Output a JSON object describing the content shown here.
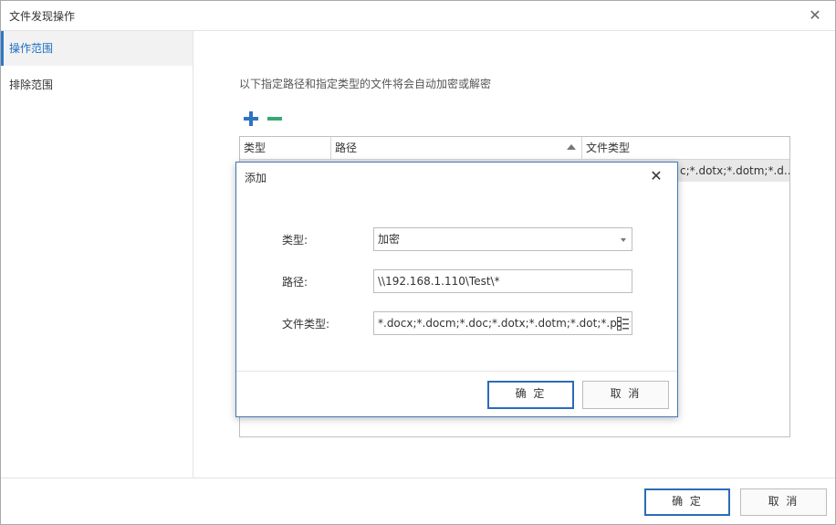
{
  "window": {
    "title": "文件发现操作",
    "close_icon": "close-icon"
  },
  "sidebar": {
    "items": [
      {
        "label": "操作范围",
        "active": true
      },
      {
        "label": "排除范围",
        "active": false
      }
    ]
  },
  "main": {
    "description": "以下指定路径和指定类型的文件将会自动加密或解密",
    "toolbar": {
      "add_icon": "plus-icon",
      "remove_icon": "minus-icon",
      "add_color": "#2f74c0",
      "remove_color": "#3aa876"
    },
    "table": {
      "columns": [
        "类型",
        "路径",
        "文件类型"
      ],
      "sorted_column": "路径",
      "rows": [
        {
          "type": "",
          "path": "",
          "file_types": "c;*.dotx;*.dotm;*.d..."
        }
      ]
    }
  },
  "footer": {
    "ok_label": "确 定",
    "cancel_label": "取 消"
  },
  "dialog": {
    "title": "添加",
    "fields": {
      "type_label": "类型:",
      "type_value": "加密",
      "path_label": "路径:",
      "path_value": "\\\\192.168.1.110\\Test\\*",
      "filetype_label": "文件类型:",
      "filetype_value": "*.docx;*.docm;*.doc;*.dotx;*.dotm;*.dot;*.pdf;"
    },
    "ok_label": "确 定",
    "cancel_label": "取 消"
  },
  "colors": {
    "accent": "#2b6cb8",
    "selected_row": "#e8e8e8"
  }
}
